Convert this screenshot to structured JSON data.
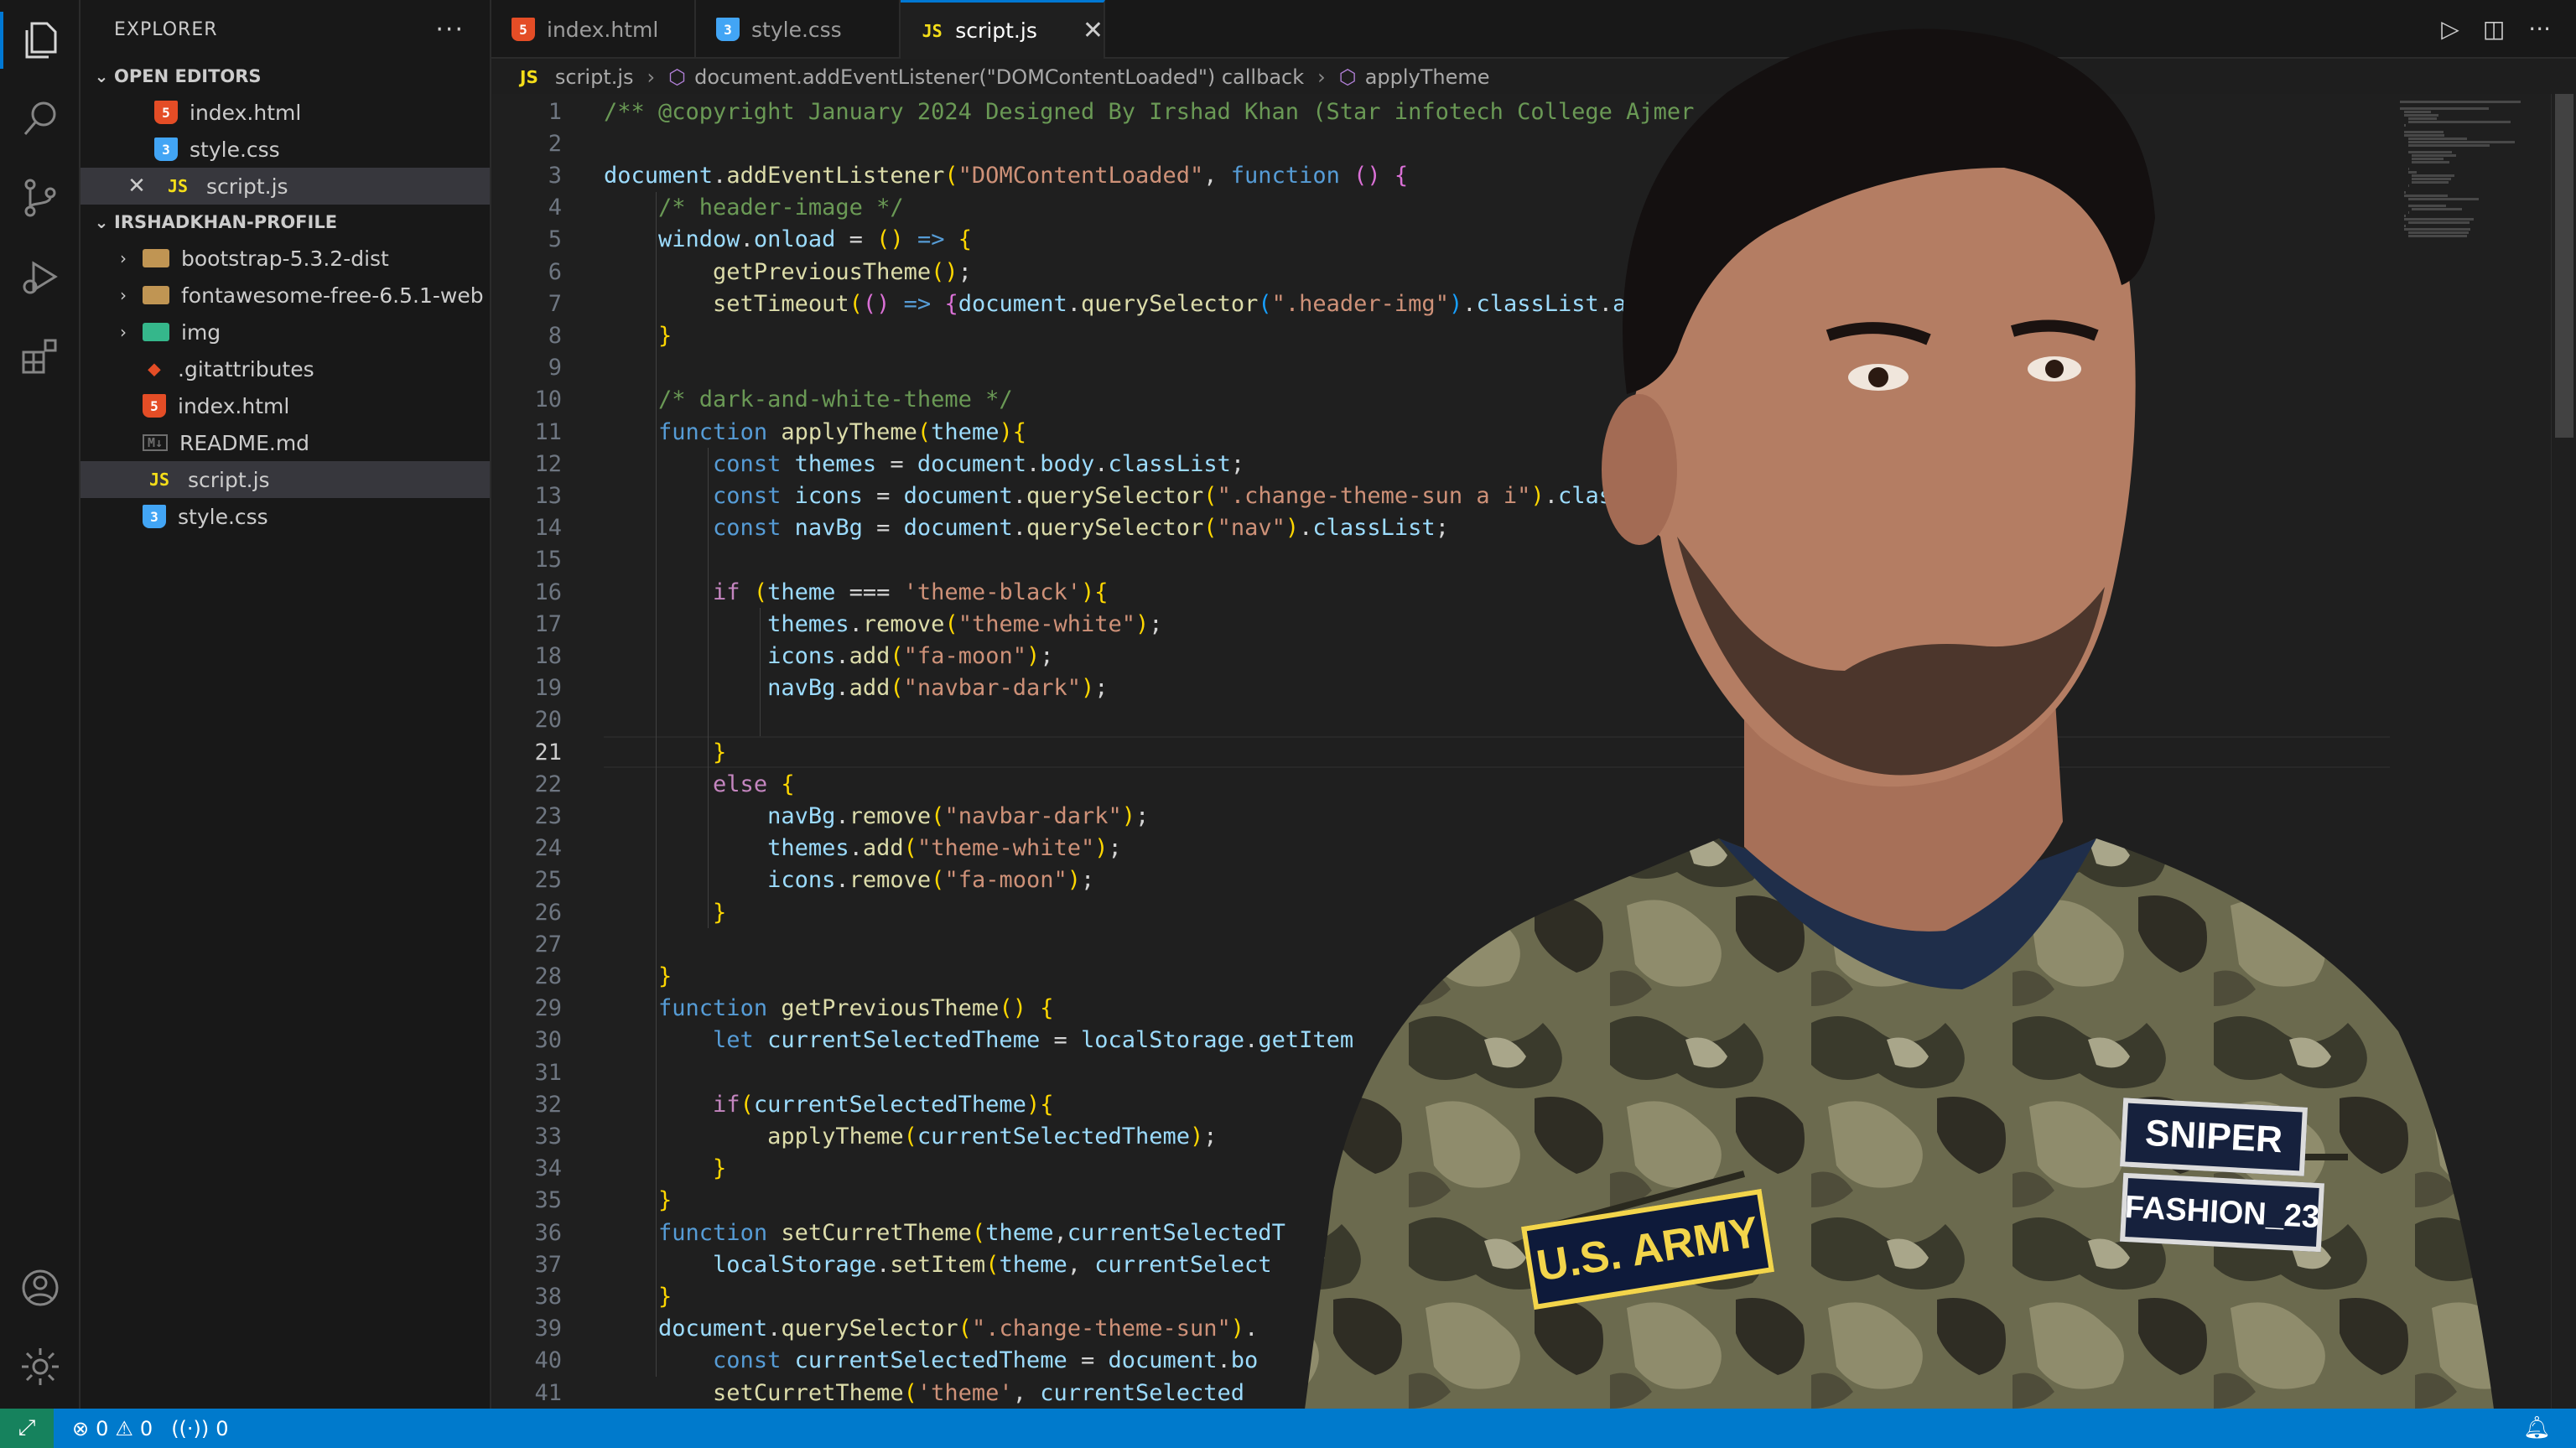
{
  "sidebar": {
    "title": "EXPLORER",
    "more": "···",
    "open_editors": {
      "label": "OPEN EDITORS",
      "items": [
        {
          "name": "index.html",
          "type": "html"
        },
        {
          "name": "style.css",
          "type": "css"
        },
        {
          "name": "script.js",
          "type": "js"
        }
      ]
    },
    "project": {
      "label": "IRSHADKHAN-PROFILE",
      "items": [
        {
          "name": "bootstrap-5.3.2-dist",
          "type": "folder"
        },
        {
          "name": "fontawesome-free-6.5.1-web",
          "type": "folder"
        },
        {
          "name": "img",
          "type": "folder-img"
        },
        {
          "name": ".gitattributes",
          "type": "git"
        },
        {
          "name": "index.html",
          "type": "html"
        },
        {
          "name": "README.md",
          "type": "md"
        },
        {
          "name": "script.js",
          "type": "js"
        },
        {
          "name": "style.css",
          "type": "css"
        }
      ]
    }
  },
  "tabs": [
    {
      "label": "index.html",
      "type": "html"
    },
    {
      "label": "style.css",
      "type": "css"
    },
    {
      "label": "script.js",
      "type": "js",
      "close": "✕"
    }
  ],
  "breadcrumb": {
    "file_badge": "JS",
    "file": "script.js",
    "callback": "document.addEventListener(\"DOMContentLoaded\") callback",
    "function": "applyTheme"
  },
  "editor": {
    "current_line": 21,
    "lines": [
      "/** @copyright January 2024 Designed By Irshad Khan (Star infotech College Ajmer",
      "",
      "document.addEventListener(\"DOMContentLoaded\", function () {",
      "    /* header-image */",
      "    window.onload = () => {",
      "        getPreviousTheme();",
      "        setTimeout(() => {document.querySelector(\".header-img\").classList.ad",
      "    }",
      "",
      "    /* dark-and-white-theme */",
      "    function applyTheme(theme){",
      "        const themes = document.body.classList;",
      "        const icons = document.querySelector(\".change-theme-sun a i\").classList",
      "        const navBg = document.querySelector(\"nav\").classList;",
      "",
      "        if (theme === 'theme-black'){",
      "            themes.remove(\"theme-white\");",
      "            icons.add(\"fa-moon\");",
      "            navBg.add(\"navbar-dark\");",
      "",
      "        }",
      "        else {",
      "            navBg.remove(\"navbar-dark\");",
      "            themes.add(\"theme-white\");",
      "            icons.remove(\"fa-moon\");",
      "        }",
      "",
      "    }",
      "    function getPreviousTheme() {",
      "        let currentSelectedTheme = localStorage.getItem",
      "",
      "        if(currentSelectedTheme){",
      "            applyTheme(currentSelectedTheme);",
      "        }",
      "    }",
      "    function setCurretTheme(theme,currentSelectedT",
      "        localStorage.setItem(theme, currentSelect",
      "    }",
      "    document.querySelector(\".change-theme-sun\").",
      "        const currentSelectedTheme = document.bo",
      "        setCurretTheme('theme', currentSelected"
    ]
  },
  "status": {
    "errors": "0",
    "warnings": "0",
    "ports": "0"
  },
  "photo": {
    "patch_left": "U.S. ARMY",
    "patch_right_top": "SNIPER",
    "patch_right_bottom": "FASHION_23"
  }
}
